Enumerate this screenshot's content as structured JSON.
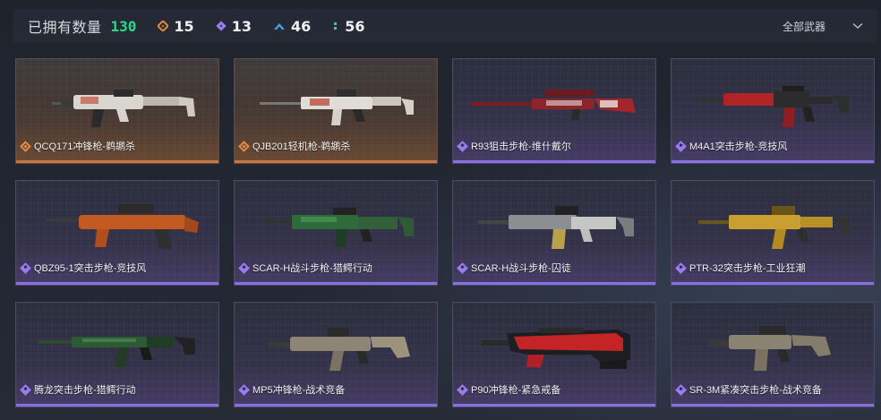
{
  "header": {
    "owned_label": "已拥有数量",
    "owned_count": "130",
    "stats": [
      {
        "icon": "orange-diamond-icon",
        "count": "15",
        "color": "#e08a45"
      },
      {
        "icon": "purple-diamond-icon",
        "count": "13",
        "color": "#9a7cf0"
      },
      {
        "icon": "blue-chevron-icon",
        "count": "46",
        "color": "#4aa3e8"
      },
      {
        "icon": "green-dots-icon",
        "count": "56",
        "color": "#2fd38c"
      }
    ],
    "filter_label": "全部武器",
    "filter_icon": "chevron-down-icon"
  },
  "weapons": [
    {
      "name": "QCQ171冲锋枪-鹈鹕杀",
      "rarity": "orange"
    },
    {
      "name": "QJB201轻机枪-鹈鹕杀",
      "rarity": "orange"
    },
    {
      "name": "R93狙击步枪-维什戴尔",
      "rarity": "purple"
    },
    {
      "name": "M4A1突击步枪-竞技风",
      "rarity": "purple"
    },
    {
      "name": "QBZ95-1突击步枪-竞技风",
      "rarity": "purple"
    },
    {
      "name": "SCAR-H战斗步枪-猎鳄行动",
      "rarity": "purple"
    },
    {
      "name": "SCAR-H战斗步枪-囚徒",
      "rarity": "purple"
    },
    {
      "name": "PTR-32突击步枪-工业狂潮",
      "rarity": "purple"
    },
    {
      "name": "腾龙突击步枪-猎鳄行动",
      "rarity": "purple"
    },
    {
      "name": "MP5冲锋枪-战术竞备",
      "rarity": "purple"
    },
    {
      "name": "P90冲锋枪-紧急戒备",
      "rarity": "purple"
    },
    {
      "name": "SR-3M紧凑突击步枪-战术竞备",
      "rarity": "purple"
    }
  ]
}
